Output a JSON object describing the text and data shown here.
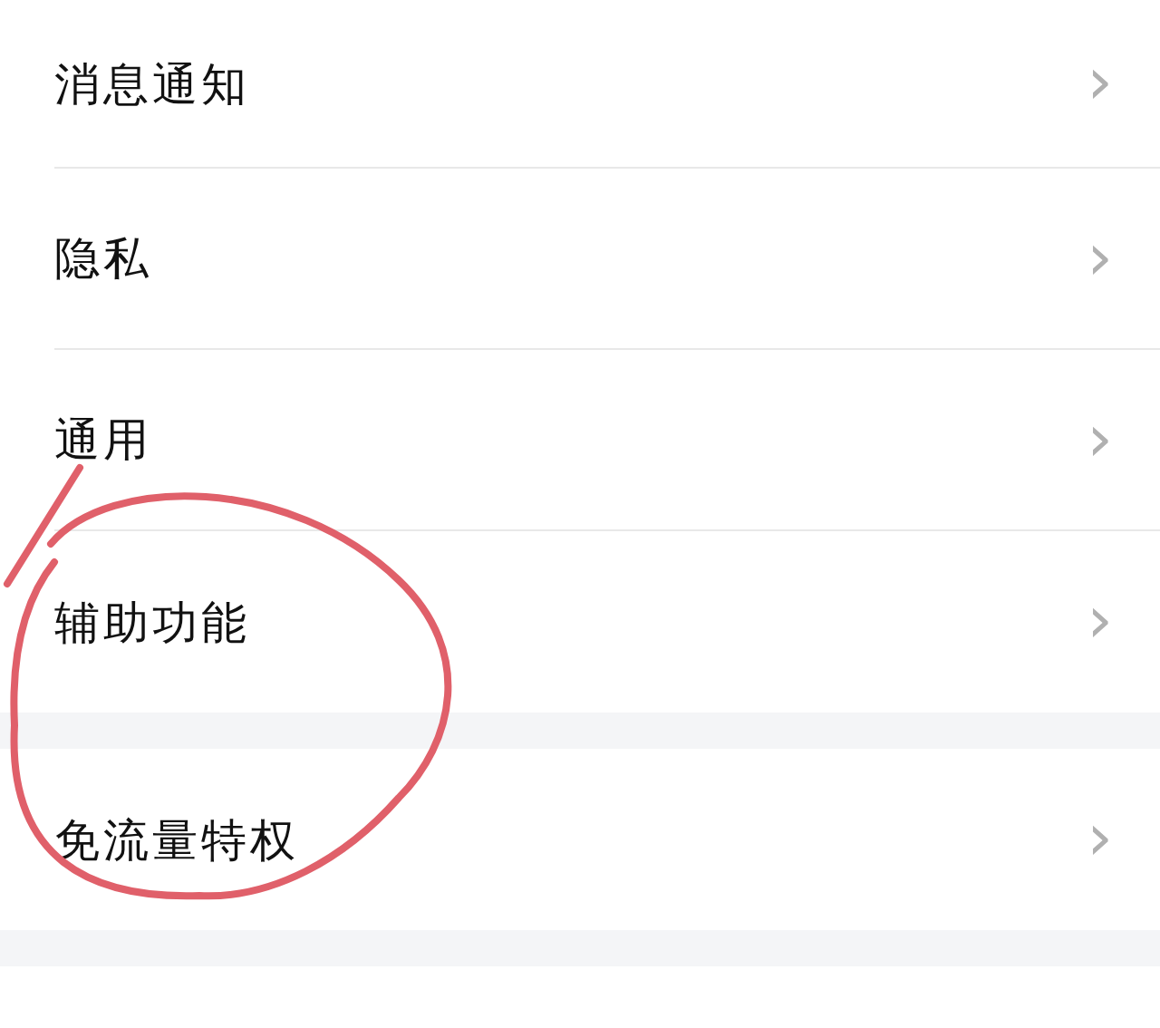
{
  "groups": [
    {
      "items": [
        {
          "label": "消息通知",
          "chevron": "›"
        },
        {
          "label": "隐私",
          "chevron": "›"
        },
        {
          "label": "通用",
          "chevron": "›"
        },
        {
          "label": "辅助功能",
          "chevron": "›"
        }
      ]
    },
    {
      "items": [
        {
          "label": "免流量特权",
          "chevron": "›"
        }
      ]
    }
  ],
  "annotation": {
    "kind": "circle",
    "color": "#e0606a"
  }
}
